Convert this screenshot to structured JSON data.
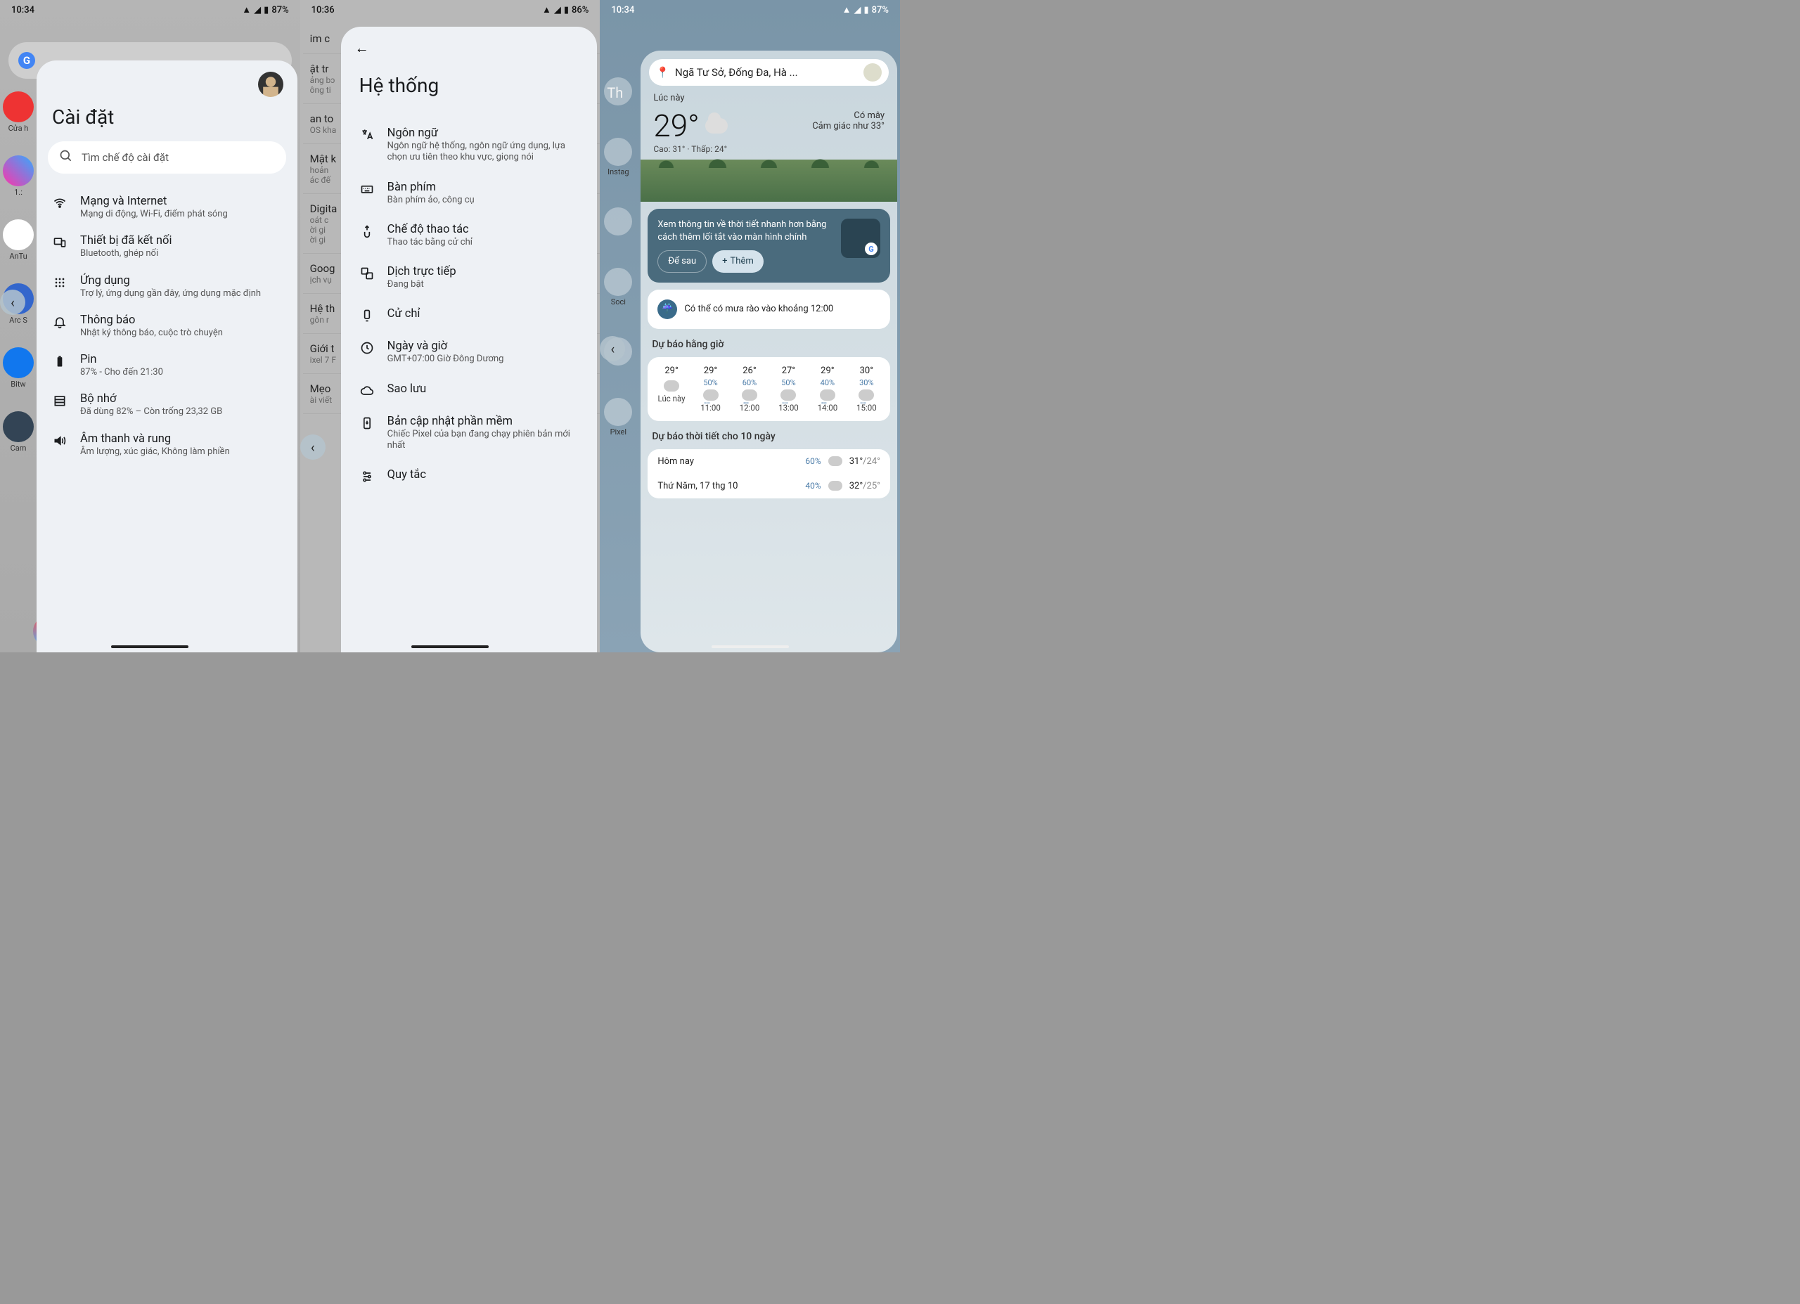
{
  "p1": {
    "status": {
      "time": "10:34",
      "battery": "87%"
    },
    "bg_apps": [
      "Cửa h",
      "1.:",
      "AnTu",
      "Arc S",
      "Bitw",
      "Cam"
    ],
    "title": "Cài đặt",
    "search_placeholder": "Tìm chế độ cài đặt",
    "rows": [
      {
        "icon": "wifi",
        "title": "Mạng và Internet",
        "sub": "Mạng di động, Wi-Fi, điểm phát sóng"
      },
      {
        "icon": "devices",
        "title": "Thiết bị đã kết nối",
        "sub": "Bluetooth, ghép nối"
      },
      {
        "icon": "apps",
        "title": "Ứng dụng",
        "sub": "Trợ lý, ứng dụng gần đây, ứng dụng mặc định"
      },
      {
        "icon": "notif",
        "title": "Thông báo",
        "sub": "Nhật ký thông báo, cuộc trò chuyện"
      },
      {
        "icon": "battery",
        "title": "Pin",
        "sub": "87% - Cho đến 21:30"
      },
      {
        "icon": "storage",
        "title": "Bộ nhớ",
        "sub": "Đã dùng 82% – Còn trống 23,32 GB"
      },
      {
        "icon": "sound",
        "title": "Âm thanh và rung",
        "sub": "Âm lượng, xúc giác, Không làm phiền"
      }
    ]
  },
  "p2": {
    "status": {
      "time": "10:36",
      "battery": "86%"
    },
    "bg_items": [
      {
        "t": "im c"
      },
      {
        "t": "ật tr",
        "s": "ảng bɔ\nông ti"
      },
      {
        "t": "an to",
        "s": "OS kha"
      },
      {
        "t": "Mật k",
        "s": "hoản\nác đế"
      },
      {
        "t": "Digita",
        "s": "oát c\nời gi\nời gi"
      },
      {
        "t": "Goog",
        "s": "ịch vụ"
      },
      {
        "t": "Hệ th",
        "s": "gôn r"
      },
      {
        "t": "Giới t",
        "s": "ixel 7 F"
      },
      {
        "t": "Mẹo",
        "s": "ài viết"
      }
    ],
    "title": "Hệ thống",
    "rows": [
      {
        "icon": "lang",
        "title": "Ngôn ngữ",
        "sub": "Ngôn ngữ hệ thống, ngôn ngữ ứng dụng, lựa chọn ưu tiên theo khu vực, giọng nói"
      },
      {
        "icon": "keyboard",
        "title": "Bàn phím",
        "sub": "Bàn phím ảo, công cụ"
      },
      {
        "icon": "gesture",
        "title": "Chế độ thao tác",
        "sub": "Thao tác bằng cử chỉ"
      },
      {
        "icon": "translate",
        "title": "Dịch trực tiếp",
        "sub": "Đang bật"
      },
      {
        "icon": "hand",
        "title": "Cử chỉ",
        "sub": ""
      },
      {
        "icon": "clock",
        "title": "Ngày và giờ",
        "sub": "GMT+07:00 Giờ Đông Dương"
      },
      {
        "icon": "cloud",
        "title": "Sao lưu",
        "sub": ""
      },
      {
        "icon": "update",
        "title": "Bản cập nhật phần mềm",
        "sub": "Chiếc Pixel của bạn đang chạy phiên bản mới nhất"
      },
      {
        "icon": "rules",
        "title": "Quy tắc",
        "sub": ""
      }
    ]
  },
  "p3": {
    "status": {
      "time": "10:34",
      "battery": "87%"
    },
    "bg_text": "Th",
    "bg_apps": [
      "",
      "Instag",
      "",
      "Soci",
      "",
      "Pixel"
    ],
    "location": "Ngã Tư Sở, Đống Đa, Hà ...",
    "now_label": "Lúc này",
    "temp": "29°",
    "cond": "Có mây",
    "feels": "Cảm giác như 33°",
    "hilo": "Cao: 31° · Thấp: 24°",
    "promo": {
      "text": "Xem thông tin về thời tiết nhanh hơn bằng cách thêm lối tắt vào màn hình chính",
      "later": "Để sau",
      "add": "Thêm"
    },
    "alert": "Có thể có mưa rào vào khoảng 12:00",
    "hourly_title": "Dự báo hằng giờ",
    "hourly": [
      {
        "t": "29°",
        "p": "",
        "lbl": "Lúc này",
        "rain": false
      },
      {
        "t": "29°",
        "p": "50%",
        "lbl": "11:00",
        "rain": true
      },
      {
        "t": "26°",
        "p": "60%",
        "lbl": "12:00",
        "rain": true
      },
      {
        "t": "27°",
        "p": "50%",
        "lbl": "13:00",
        "rain": true
      },
      {
        "t": "29°",
        "p": "40%",
        "lbl": "14:00",
        "rain": true
      },
      {
        "t": "30°",
        "p": "30%",
        "lbl": "15:00",
        "rain": true
      }
    ],
    "daily_title": "Dự báo thời tiết cho 10 ngày",
    "daily": [
      {
        "n": "Hôm nay",
        "p": "60%",
        "hi": "31°",
        "lo": "/24°"
      },
      {
        "n": "Thứ Năm, 17 thg 10",
        "p": "40%",
        "hi": "32°",
        "lo": "/25°"
      }
    ]
  }
}
